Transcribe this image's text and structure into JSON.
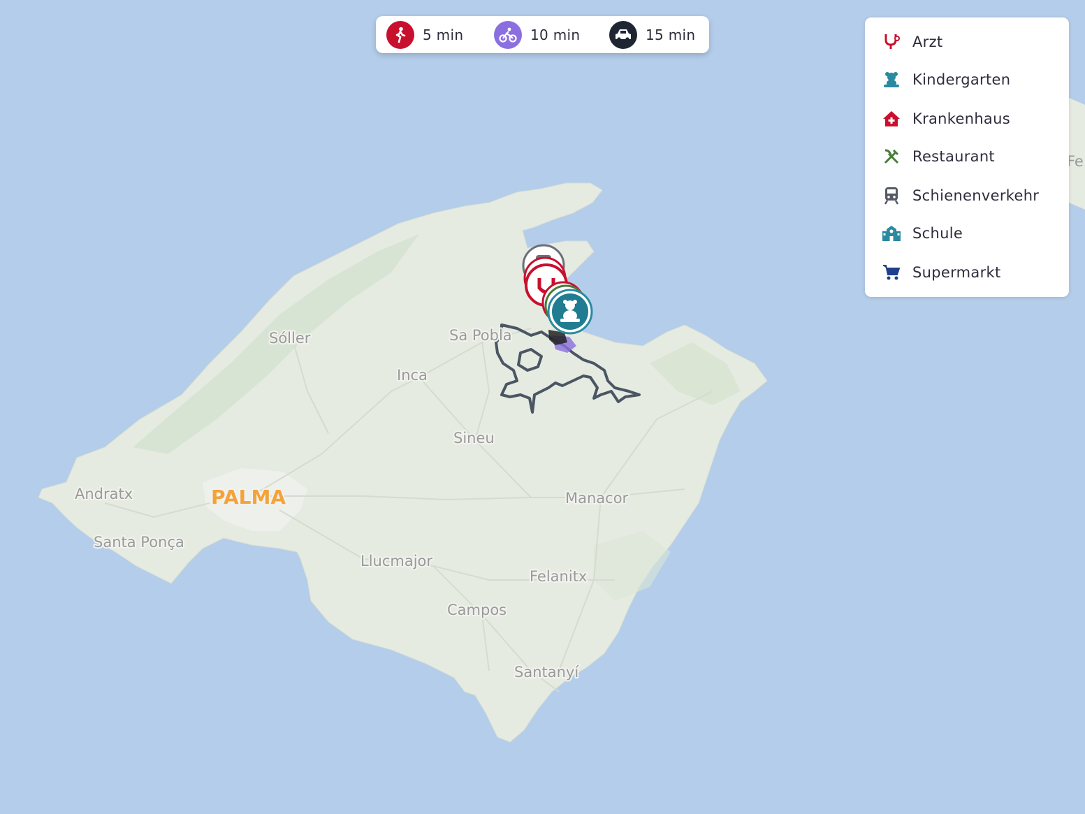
{
  "travel_modes": [
    {
      "id": "walk",
      "label": "5 min",
      "icon": "walking-person-icon",
      "color": "#c8102e"
    },
    {
      "id": "bike",
      "label": "10 min",
      "icon": "bicycle-icon",
      "color": "#8b6fe0"
    },
    {
      "id": "car",
      "label": "15 min",
      "icon": "car-icon",
      "color": "#1f2533"
    }
  ],
  "legend": [
    {
      "label": "Arzt",
      "icon": "stethoscope-icon",
      "color": "#c8102e"
    },
    {
      "label": "Kindergarten",
      "icon": "teddy-bear-icon",
      "color": "#2a8aa0"
    },
    {
      "label": "Krankenhaus",
      "icon": "hospital-icon",
      "color": "#c8102e"
    },
    {
      "label": "Restaurant",
      "icon": "fork-knife-icon",
      "color": "#4a7a3c"
    },
    {
      "label": "Schienenverkehr",
      "icon": "train-icon",
      "color": "#555a66"
    },
    {
      "label": "Schule",
      "icon": "school-icon",
      "color": "#2a8aa0"
    },
    {
      "label": "Supermarkt",
      "icon": "shopping-cart-icon",
      "color": "#1e3f8a"
    }
  ],
  "map": {
    "places": [
      "Sóller",
      "Sa Pobla",
      "Inca",
      "Sineu",
      "Andratx",
      "PALMA",
      "Manacor",
      "Santa Ponça",
      "Llucmajor",
      "Felanitx",
      "Campos",
      "Santanyí"
    ],
    "edge_label": "Fe",
    "colors": {
      "sea": "#b3cdea",
      "land": "#e5ebe1",
      "isochrone": "#4b5563"
    }
  }
}
